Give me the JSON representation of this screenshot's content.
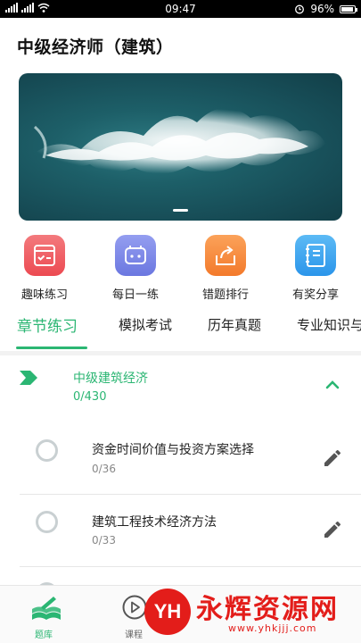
{
  "status_bar": {
    "time": "09:47",
    "battery": "96%",
    "battery_level": 0.96,
    "signal_label_1": "4G",
    "signal_label_2": "46"
  },
  "header": {
    "title": "中级经济师（建筑）"
  },
  "banner": {
    "slide_count": 1,
    "active_slide": 1
  },
  "quick_actions": [
    {
      "label": "趣味练习",
      "icon": "quiz-board-icon",
      "color": "#f05a5f"
    },
    {
      "label": "每日一练",
      "icon": "calendar-icon",
      "color": "#7b86e6"
    },
    {
      "label": "错题排行",
      "icon": "share-box-icon",
      "color": "#f58a3c"
    },
    {
      "label": "有奖分享",
      "icon": "notebook-icon",
      "color": "#3aa6f0"
    }
  ],
  "tabs": [
    {
      "label": "章节练习",
      "active": true
    },
    {
      "label": "模拟考试",
      "active": false
    },
    {
      "label": "历年真题",
      "active": false
    },
    {
      "label": "专业知识与",
      "active": false
    }
  ],
  "chapter": {
    "title": "中级建筑经济",
    "count": "0/430",
    "expanded": true
  },
  "items": [
    {
      "title": "资金时间价值与投资方案选择",
      "count": "0/36"
    },
    {
      "title": "建筑工程技术经济方法",
      "count": "0/33"
    }
  ],
  "bottom_nav": [
    {
      "label": "题库",
      "active": true
    },
    {
      "label": "课程",
      "active": false
    }
  ],
  "watermark": {
    "logo_text": "YH",
    "text": "永辉资源网",
    "url": "www.yhkjjj.com"
  },
  "colors": {
    "accent": "#2bb673",
    "watermark": "#e31d1a"
  }
}
